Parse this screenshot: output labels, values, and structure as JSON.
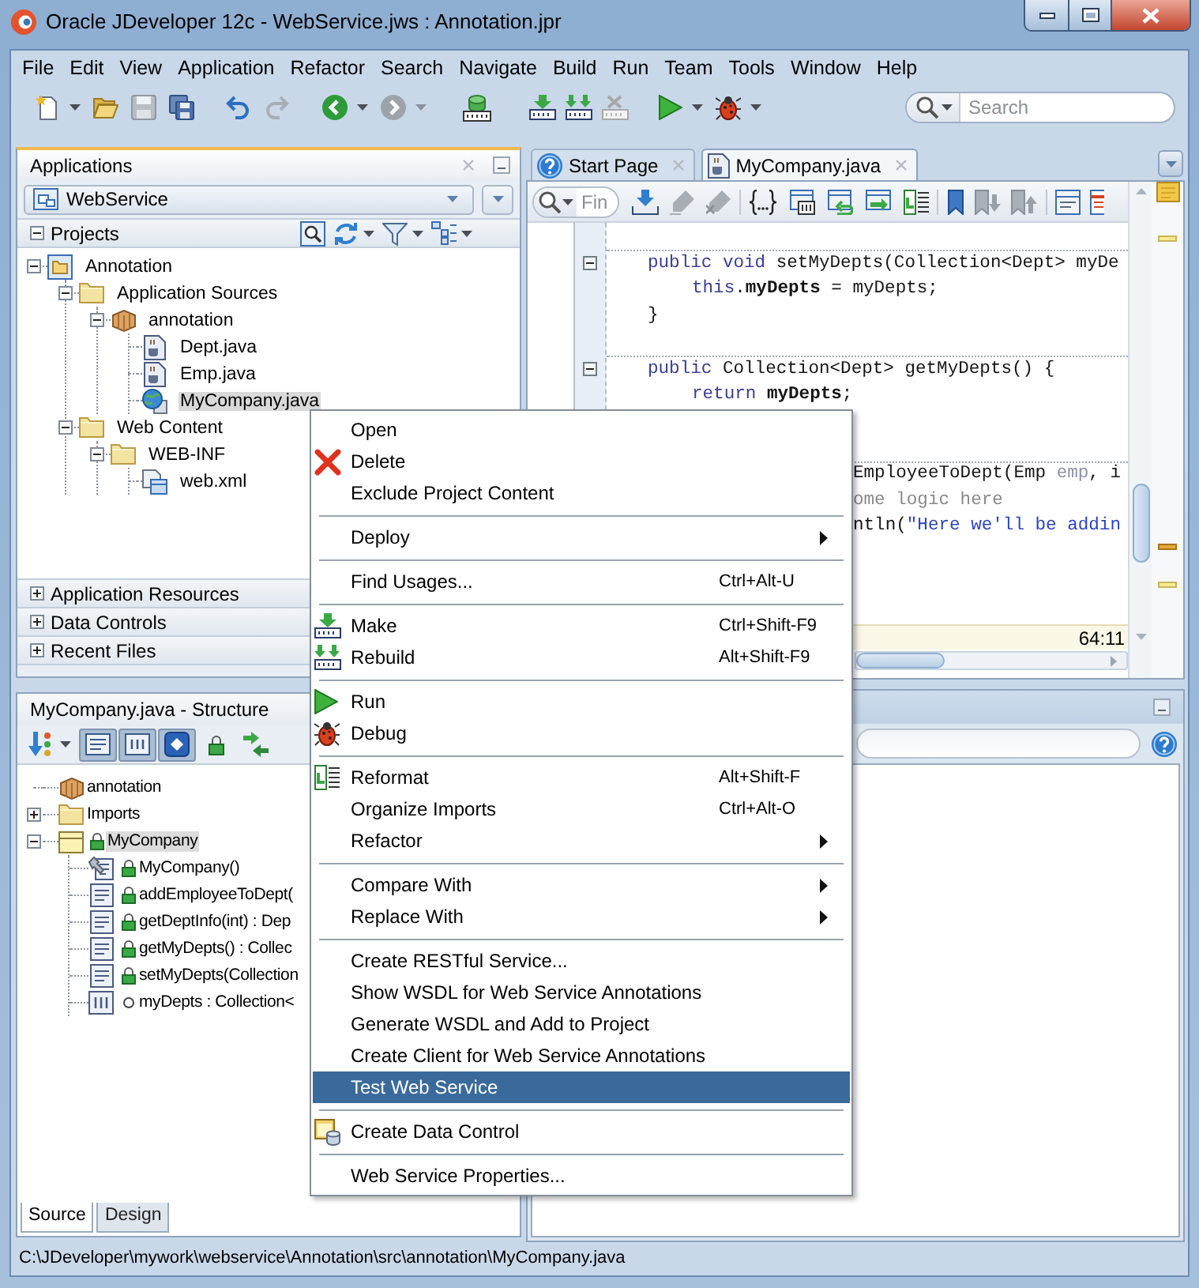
{
  "window": {
    "title": "Oracle JDeveloper 12c - WebService.jws : Annotation.jpr"
  },
  "menu_bar": [
    "File",
    "Edit",
    "View",
    "Application",
    "Refactor",
    "Search",
    "Navigate",
    "Build",
    "Run",
    "Team",
    "Tools",
    "Window",
    "Help"
  ],
  "toolbar": {
    "groups": [
      [
        {
          "disabled": false,
          "dropdown": true
        },
        {
          "disabled": false,
          "dropdown": false
        },
        {
          "disabled": true,
          "dropdown": false
        },
        {
          "disabled": false,
          "dropdown": false
        }
      ],
      [
        {
          "disabled": false,
          "dropdown": false
        },
        {
          "disabled": true,
          "dropdown": false
        }
      ],
      [
        {
          "disabled": false,
          "dropdown": true
        },
        {
          "disabled": true,
          "dropdown": true
        }
      ],
      [
        {
          "disabled": false,
          "dropdown": false
        }
      ],
      [
        {
          "disabled": false,
          "dropdown": false
        },
        {
          "disabled": false,
          "dropdown": false
        },
        {
          "disabled": true,
          "dropdown": false
        }
      ],
      [
        {
          "disabled": false,
          "dropdown": true
        },
        {
          "disabled": false,
          "dropdown": true
        }
      ]
    ],
    "search": {
      "placeholder": "Search"
    }
  },
  "applications": {
    "title": "Applications",
    "selector": {
      "value": "WebService"
    },
    "projects": {
      "title": "Projects",
      "expanded": true,
      "tree": [
        {
          "label": "Annotation",
          "kind": "project",
          "expanded": true,
          "selected": false,
          "children": [
            {
              "label": "Application Sources",
              "kind": "folder",
              "expanded": true,
              "selected": false,
              "children": [
                {
                  "label": "annotation",
                  "kind": "package",
                  "expanded": true,
                  "selected": false,
                  "children": [
                    {
                      "label": "Dept.java",
                      "kind": "java",
                      "selected": false
                    },
                    {
                      "label": "Emp.java",
                      "kind": "java",
                      "selected": false
                    },
                    {
                      "label": "MyCompany.java",
                      "kind": "webservice",
                      "selected": true
                    }
                  ]
                }
              ]
            },
            {
              "label": "Web Content",
              "kind": "folder",
              "expanded": true,
              "selected": false,
              "children": [
                {
                  "label": "WEB-INF",
                  "kind": "folder",
                  "expanded": true,
                  "selected": false,
                  "children": [
                    {
                      "label": "web.xml",
                      "kind": "xml",
                      "selected": false
                    }
                  ]
                }
              ]
            }
          ]
        }
      ]
    },
    "sections": [
      {
        "title": "Application Resources",
        "expanded": false
      },
      {
        "title": "Data Controls",
        "expanded": false
      },
      {
        "title": "Recent Files",
        "expanded": false
      }
    ]
  },
  "structure": {
    "title": "MyCompany.java - Structure",
    "toolbar": [
      {
        "pressed": false,
        "dropdown": true
      },
      {
        "pressed": true,
        "dropdown": false
      },
      {
        "pressed": true,
        "dropdown": false
      },
      {
        "pressed": true,
        "dropdown": false
      },
      {
        "pressed": false,
        "dropdown": false
      },
      {
        "pressed": false,
        "dropdown": false
      }
    ],
    "tree": [
      {
        "label": "annotation",
        "kind": "package",
        "selected": false
      },
      {
        "label": "Imports",
        "kind": "folder",
        "expanded": false,
        "selected": false
      },
      {
        "label": "MyCompany",
        "kind": "class",
        "public": true,
        "expanded": true,
        "selected": true,
        "children": [
          {
            "label": "MyCompany()",
            "kind": "constructor",
            "public": true,
            "selected": false
          },
          {
            "label": "addEmployeeToDept(",
            "kind": "method",
            "public": true,
            "selected": false
          },
          {
            "label": "getDeptInfo(int) : Dep",
            "kind": "method",
            "public": true,
            "selected": false
          },
          {
            "label": "getMyDepts() : Collec",
            "kind": "method",
            "public": true,
            "selected": false
          },
          {
            "label": "setMyDepts(Collection",
            "kind": "method",
            "public": true,
            "selected": false
          },
          {
            "label": "myDepts : Collection<",
            "kind": "field",
            "public": false,
            "selected": false
          }
        ]
      }
    ],
    "tabs": [
      {
        "label": "Source",
        "selected": true
      },
      {
        "label": "Design",
        "selected": false
      }
    ]
  },
  "editor": {
    "tabs": [
      {
        "label": "Start Page",
        "kind": "start-page",
        "selected": false
      },
      {
        "label": "MyCompany.java",
        "kind": "java-file",
        "selected": true
      }
    ],
    "find": {
      "placeholder": "Fin"
    },
    "toolbar": {
      "groups": [
        [
          {
            "disabled": false
          },
          {
            "disabled": true
          },
          {
            "disabled": true
          }
        ],
        [
          {
            "disabled": false
          },
          {
            "disabled": false
          },
          {
            "disabled": false
          },
          {
            "disabled": false
          },
          {
            "disabled": false
          }
        ],
        [
          {
            "disabled": false
          },
          {
            "disabled": true
          },
          {
            "disabled": true
          }
        ],
        [
          {
            "disabled": false
          },
          {
            "disabled": false
          }
        ]
      ]
    },
    "lines": [
      {
        "kind": "method",
        "tokens": [
          {
            "kind": "keyword",
            "text": "public void"
          },
          {
            "kind": "plain",
            "text": " setMyDepts(Collection<Dept> myDe"
          }
        ]
      },
      {
        "kind": "statement",
        "tokens": [
          {
            "kind": "keyword",
            "text": "this"
          },
          {
            "kind": "plain",
            "text": "."
          },
          {
            "kind": "field",
            "text": "myDepts"
          },
          {
            "kind": "plain",
            "text": " = myDepts;"
          }
        ]
      },
      {
        "kind": "brace",
        "tokens": [
          {
            "kind": "plain",
            "text": "}"
          }
        ]
      },
      {
        "kind": "blank"
      },
      {
        "kind": "method",
        "tokens": [
          {
            "kind": "keyword",
            "text": "public"
          },
          {
            "kind": "plain",
            "text": " Collection<Dept> getMyDepts() {"
          }
        ]
      },
      {
        "kind": "statement",
        "tokens": [
          {
            "kind": "keyword",
            "text": "return"
          },
          {
            "kind": "field",
            "text": " myDepts"
          },
          {
            "kind": "plain",
            "text": ";"
          }
        ]
      },
      {
        "kind": "blank"
      },
      {
        "kind": "blank"
      },
      {
        "kind": "clipped-method",
        "tokens": [
          {
            "kind": "plain",
            "text": "EmployeeToDept(Emp "
          },
          {
            "kind": "param",
            "text": "emp"
          },
          {
            "kind": "plain",
            "text": ", i"
          }
        ]
      },
      {
        "kind": "clipped",
        "tokens": [
          {
            "kind": "comment",
            "text": "ome logic here"
          }
        ]
      },
      {
        "kind": "clipped",
        "tokens": [
          {
            "kind": "plain",
            "text": "ntln("
          },
          {
            "kind": "string",
            "text": "\"Here we'll be addin"
          }
        ]
      }
    ],
    "position": "64:11"
  },
  "context_menu": {
    "groups": [
      [
        {
          "label": "Open",
          "submenu": false,
          "selected": false
        },
        {
          "label": "Delete",
          "submenu": false,
          "selected": false
        },
        {
          "label": "Exclude Project Content",
          "submenu": false,
          "selected": false
        }
      ],
      [
        {
          "label": "Deploy",
          "submenu": true,
          "selected": false
        }
      ],
      [
        {
          "label": "Find Usages...",
          "shortcut": "Ctrl+Alt-U",
          "submenu": false,
          "selected": false
        }
      ],
      [
        {
          "label": "Make",
          "shortcut": "Ctrl+Shift-F9",
          "submenu": false,
          "selected": false
        },
        {
          "label": "Rebuild",
          "shortcut": "Alt+Shift-F9",
          "submenu": false,
          "selected": false
        }
      ],
      [
        {
          "label": "Run",
          "submenu": false,
          "selected": false
        },
        {
          "label": "Debug",
          "submenu": false,
          "selected": false
        }
      ],
      [
        {
          "label": "Reformat",
          "shortcut": "Alt+Shift-F",
          "submenu": false,
          "selected": false
        },
        {
          "label": "Organize Imports",
          "shortcut": "Ctrl+Alt-O",
          "submenu": false,
          "selected": false
        },
        {
          "label": "Refactor",
          "submenu": true,
          "selected": false
        }
      ],
      [
        {
          "label": "Compare With",
          "submenu": true,
          "selected": false
        },
        {
          "label": "Replace With",
          "submenu": true,
          "selected": false
        }
      ],
      [
        {
          "label": "Create RESTful Service...",
          "submenu": false,
          "selected": false
        },
        {
          "label": "Show WSDL for Web Service Annotations",
          "submenu": false,
          "selected": false
        },
        {
          "label": "Generate WSDL and Add to Project",
          "submenu": false,
          "selected": false
        },
        {
          "label": "Create Client for Web Service Annotations",
          "submenu": false,
          "selected": false
        },
        {
          "label": "Test Web Service",
          "submenu": false,
          "selected": true
        }
      ],
      [
        {
          "label": "Create Data Control",
          "submenu": false,
          "selected": false
        }
      ],
      [
        {
          "label": "Web Service Properties...",
          "submenu": false,
          "selected": false
        }
      ]
    ]
  },
  "status_bar": {
    "path": "C:\\JDeveloper\\mywork\\webservice\\Annotation\\src\\annotation\\MyCompany.java"
  }
}
